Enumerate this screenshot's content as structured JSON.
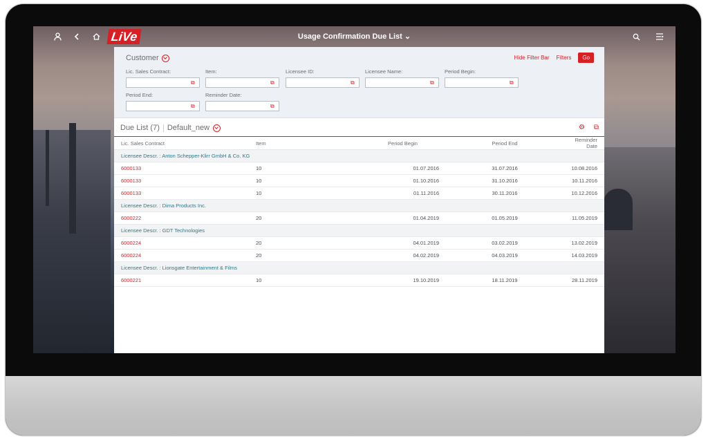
{
  "shell": {
    "logo": "LiVe",
    "title": "Usage Confirmation Due List",
    "icons": [
      "user-icon",
      "back-icon",
      "home-icon",
      "search-icon",
      "menu-icon"
    ]
  },
  "filter_bar": {
    "variant": "Customer",
    "hide_label": "Hide Filter Bar",
    "filters_label": "Filters",
    "go_label": "Go",
    "fields": [
      {
        "label": "Lic. Sales Contract:",
        "value": ""
      },
      {
        "label": "Item:",
        "value": ""
      },
      {
        "label": "Licensee ID:",
        "value": ""
      },
      {
        "label": "Licensee Name:",
        "value": ""
      },
      {
        "label": "Period Begin:",
        "value": ""
      },
      {
        "label": "Period End:",
        "value": ""
      },
      {
        "label": "Reminder Date:",
        "value": ""
      }
    ]
  },
  "table": {
    "title": "Due List (7)",
    "variant": "Default_new",
    "columns": [
      "Lic. Sales Contract",
      "Item",
      "Period Begin",
      "Period End",
      "Reminder Date"
    ],
    "groups": [
      {
        "label": "Licensee Descr. : Anton Schepper-Klirr GmbH & Co. KG",
        "rows": [
          [
            "6000133",
            "10",
            "01.07.2016",
            "31.07.2016",
            "10.08.2016"
          ],
          [
            "6000133",
            "10",
            "01.10.2016",
            "31.10.2016",
            "10.11.2016"
          ],
          [
            "6000133",
            "10",
            "01.11.2016",
            "30.11.2016",
            "10.12.2016"
          ]
        ]
      },
      {
        "label": "Licensee Descr. : Dima Products Inc.",
        "rows": [
          [
            "6000222",
            "20",
            "01.04.2019",
            "01.05.2019",
            "11.05.2019"
          ]
        ]
      },
      {
        "label": "Licensee Descr. : GDT Technologies",
        "rows": [
          [
            "6000224",
            "20",
            "04.01.2019",
            "03.02.2019",
            "13.02.2019"
          ],
          [
            "6000224",
            "20",
            "04.02.2019",
            "04.03.2019",
            "14.03.2019"
          ]
        ]
      },
      {
        "label": "Licensee Descr. : Lionsgate Entertainment & Films",
        "rows": [
          [
            "6000221",
            "10",
            "19.10.2019",
            "18.11.2019",
            "28.11.2019"
          ]
        ]
      }
    ]
  },
  "colors": {
    "accent": "#d71f26",
    "group_text": "#297a8a"
  }
}
